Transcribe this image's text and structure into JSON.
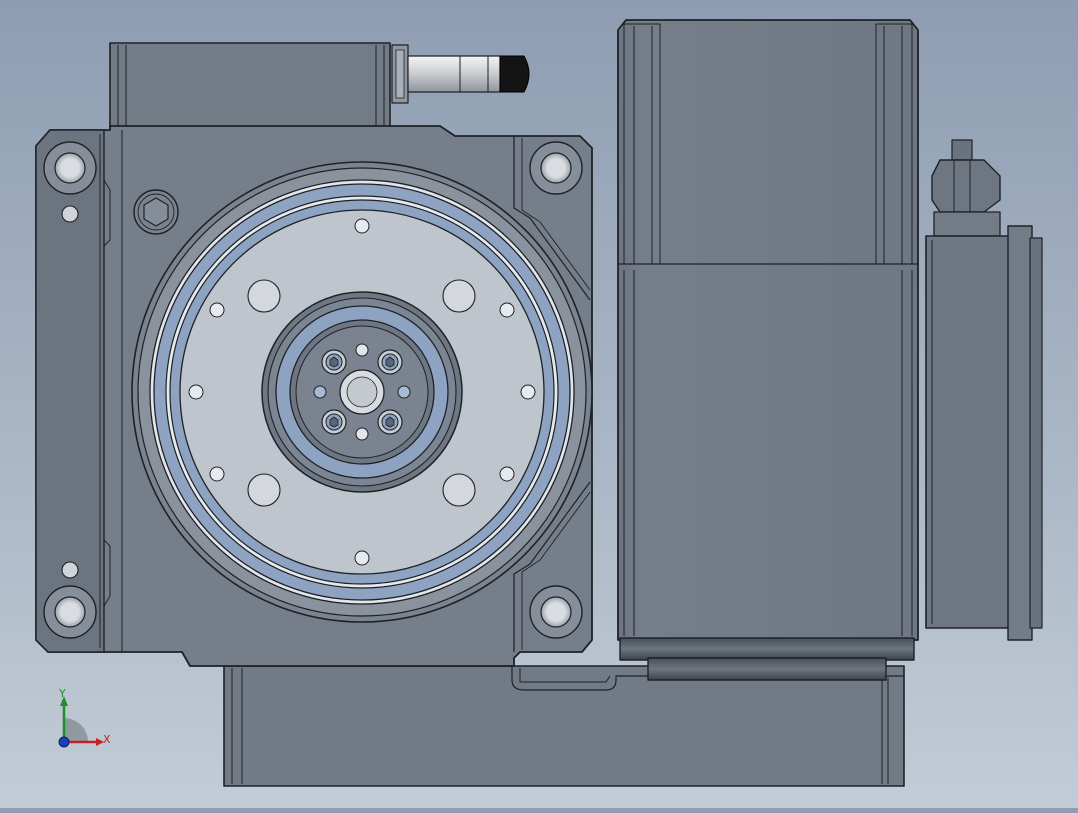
{
  "viewport": {
    "background_top": "#8e9db2",
    "background_bottom": "#c2ccd6"
  },
  "triad": {
    "x_label": "X",
    "y_label": "Y",
    "x_color": "#c4202a",
    "y_color": "#1f8f2d",
    "z_color": "#1d3fb5"
  },
  "model": {
    "body_color": "#767d88",
    "edge_color": "#1e2226",
    "ring_color": "#8ea3c2",
    "disc_color": "#bfc5cd"
  }
}
